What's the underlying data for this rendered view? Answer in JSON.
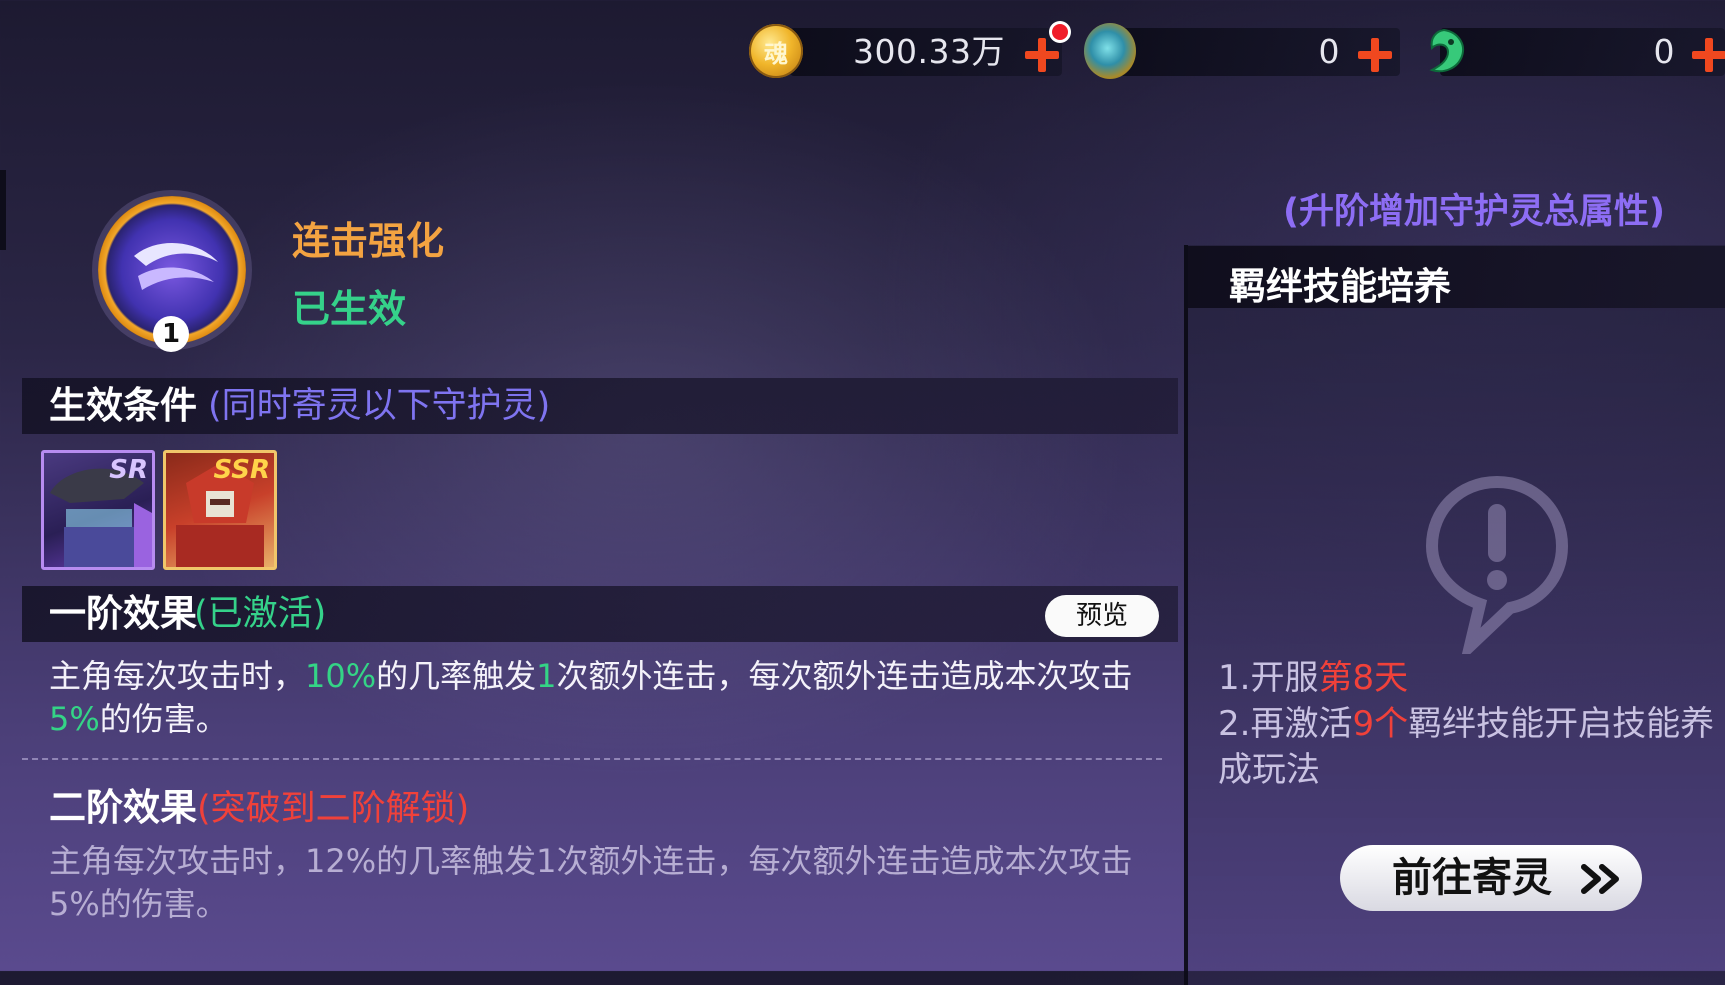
{
  "currency": {
    "coins": {
      "icon": "coin-icon",
      "glyph": "魂",
      "value": "300.33万",
      "has_notification": true
    },
    "gems": {
      "icon": "dragon-gem-icon",
      "value": "0"
    },
    "spirit": {
      "icon": "green-spirit-icon",
      "value": "0"
    }
  },
  "skill": {
    "icon": "combo-swirl-icon",
    "level": "1",
    "name": "连击强化",
    "status": "已生效"
  },
  "conditions": {
    "title": "生效条件",
    "subtitle": "(同时寄灵以下守护灵)",
    "cards": [
      {
        "rarity": "SR",
        "portrait": "hooded-ninja-portrait"
      },
      {
        "rarity": "SSR",
        "portrait": "armored-mecha-portrait"
      }
    ]
  },
  "tier1": {
    "title": "一阶效果",
    "status": "(已激活)",
    "preview_label": "预览",
    "desc_parts": [
      "主角每次攻击时，",
      "10%",
      "的几率触发",
      "1",
      "次额外连击，每次额外连击造成本次攻击",
      "5%",
      "的伤害。"
    ]
  },
  "tier2": {
    "title": "二阶效果",
    "status": "(突破到二阶解锁)",
    "desc": "主角每次攻击时，12%的几率触发1次额外连击，每次额外连击造成本次攻击5%的伤害。"
  },
  "right_panel": {
    "note": "(升阶增加守护灵总属性)",
    "title": "羁绊技能培养",
    "requirements": [
      {
        "prefix": "1.开服",
        "highlight": "第8天",
        "suffix": ""
      },
      {
        "prefix": "2.再激活",
        "highlight": "9个",
        "suffix": "羁绊技能开启技能养"
      }
    ],
    "requirement_cont": "成玩法",
    "go_button": "前往寄灵"
  },
  "colors": {
    "orange": "#f3a341",
    "green": "#35d28a",
    "purple_note": "#8d6df4",
    "red": "#f0413a"
  }
}
